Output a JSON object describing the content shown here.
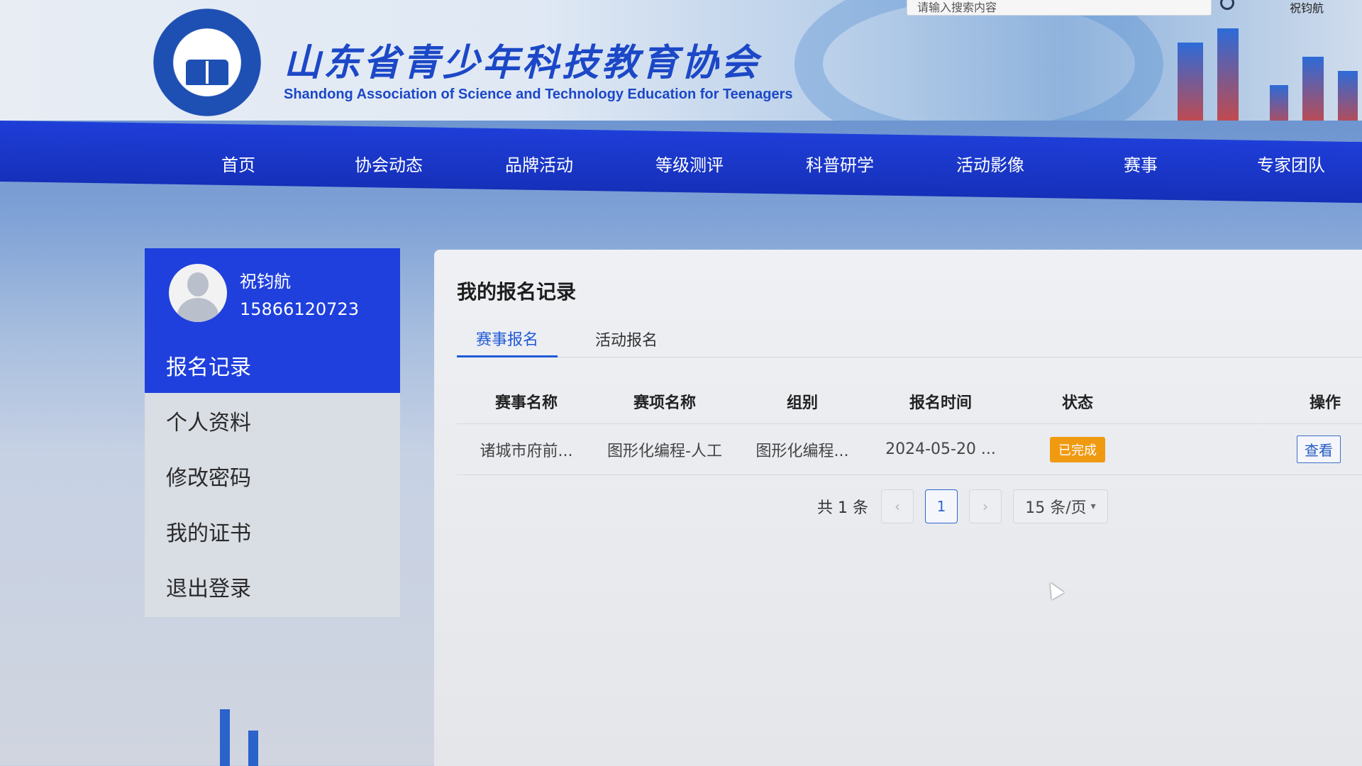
{
  "header": {
    "title_cn": "山东省青少年科技教育协会",
    "title_en": "Shandong Association of Science and Technology Education for Teenagers",
    "search_placeholder": "请输入搜索内容",
    "user_name": "祝钧航"
  },
  "nav": {
    "items": [
      "首页",
      "协会动态",
      "品牌活动",
      "等级测评",
      "科普研学",
      "活动影像",
      "赛事",
      "专家团队"
    ]
  },
  "sidebar": {
    "name": "祝钧航",
    "phone": "15866120723",
    "items": [
      "报名记录",
      "个人资料",
      "修改密码",
      "我的证书",
      "退出登录"
    ]
  },
  "main": {
    "title": "我的报名记录",
    "tabs": [
      "赛事报名",
      "活动报名"
    ],
    "columns": [
      "赛事名称",
      "赛项名称",
      "组别",
      "报名时间",
      "状态",
      "操作"
    ],
    "rows": [
      {
        "event": "诸城市府前...",
        "item": "图形化编程-人工",
        "group": "图形化编程...",
        "time": "2024-05-20 ...",
        "status": "已完成",
        "action": "查看"
      }
    ],
    "pagination": {
      "total": "共 1 条",
      "prev": "‹",
      "current": "1",
      "next": "›",
      "page_size": "15 条/页"
    }
  },
  "colors": {
    "nav_blue": "#1f3ed8",
    "accent_blue": "#1f5ad6",
    "status_orange": "#f09a12"
  }
}
